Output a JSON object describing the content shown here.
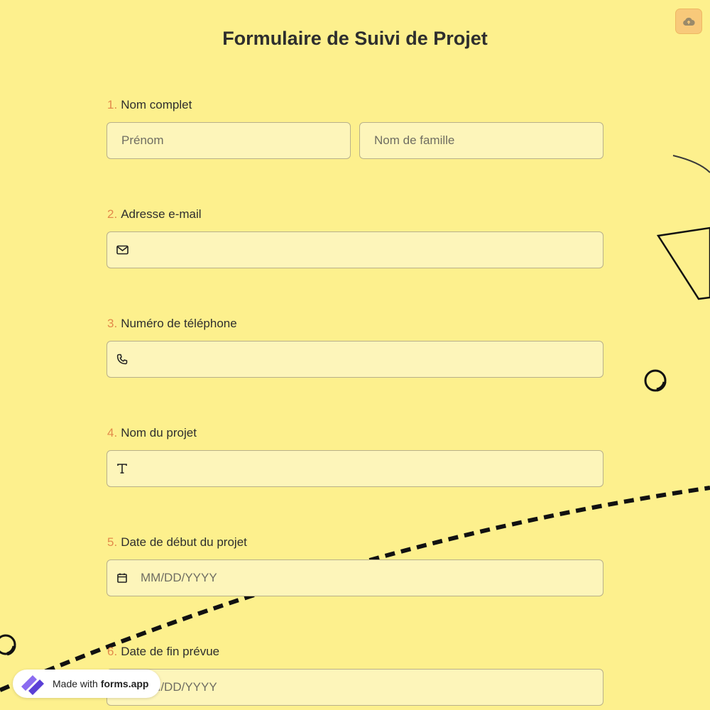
{
  "form": {
    "title": "Formulaire de Suivi de Projet",
    "questions": [
      {
        "number": "1.",
        "label": "Nom complet",
        "first_placeholder": "Prénom",
        "last_placeholder": "Nom de famille"
      },
      {
        "number": "2.",
        "label": "Adresse e-mail",
        "icon": "mail-icon"
      },
      {
        "number": "3.",
        "label": "Numéro de téléphone",
        "icon": "phone-icon"
      },
      {
        "number": "4.",
        "label": "Nom du projet",
        "icon": "text-icon"
      },
      {
        "number": "5.",
        "label": "Date de début du projet",
        "placeholder": "MM/DD/YYYY",
        "icon": "calendar-icon"
      },
      {
        "number": "6.",
        "label": "Date de fin prévue",
        "placeholder": "MM/DD/YYYY"
      }
    ]
  },
  "upload_button": {
    "icon": "cloud-upload-icon"
  },
  "badge": {
    "prefix": "Made with",
    "brand": "forms.app"
  },
  "colors": {
    "background": "#fdf08d",
    "input_bg": "#fdf5ba",
    "number_accent": "#e28a4b"
  }
}
